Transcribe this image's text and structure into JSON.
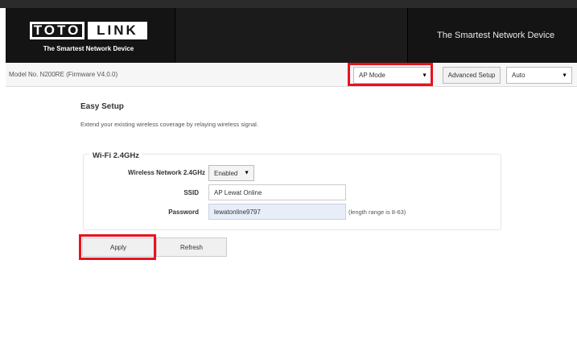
{
  "header": {
    "logo_left": "TOTO",
    "logo_right": "LINK",
    "logo_tagline": "The Smartest Network Device",
    "slogan": "The Smartest Network Device"
  },
  "infobar": {
    "model": "Model No. N200RE (Firmware V4.0.0)",
    "mode_select": "AP Mode",
    "advanced_setup": "Advanced Setup",
    "language_select": "Auto"
  },
  "main": {
    "title": "Easy Setup",
    "description": "Extend your existing wireless coverage by relaying wireless signal.",
    "wifi_section": {
      "legend": "Wi-Fi 2.4GHz",
      "wireless_label": "Wireless Network 2.4GHz",
      "wireless_value": "Enabled",
      "ssid_label": "SSID",
      "ssid_value": "AP Lewat Online",
      "password_label": "Password",
      "password_value": "lewatonline9797",
      "password_hint": "(length range is 8-63)"
    },
    "apply_label": "Apply",
    "refresh_label": "Refresh"
  },
  "highlight_color": "#e8131f",
  "icons": {
    "dropdown": "triangle-down-icon"
  }
}
